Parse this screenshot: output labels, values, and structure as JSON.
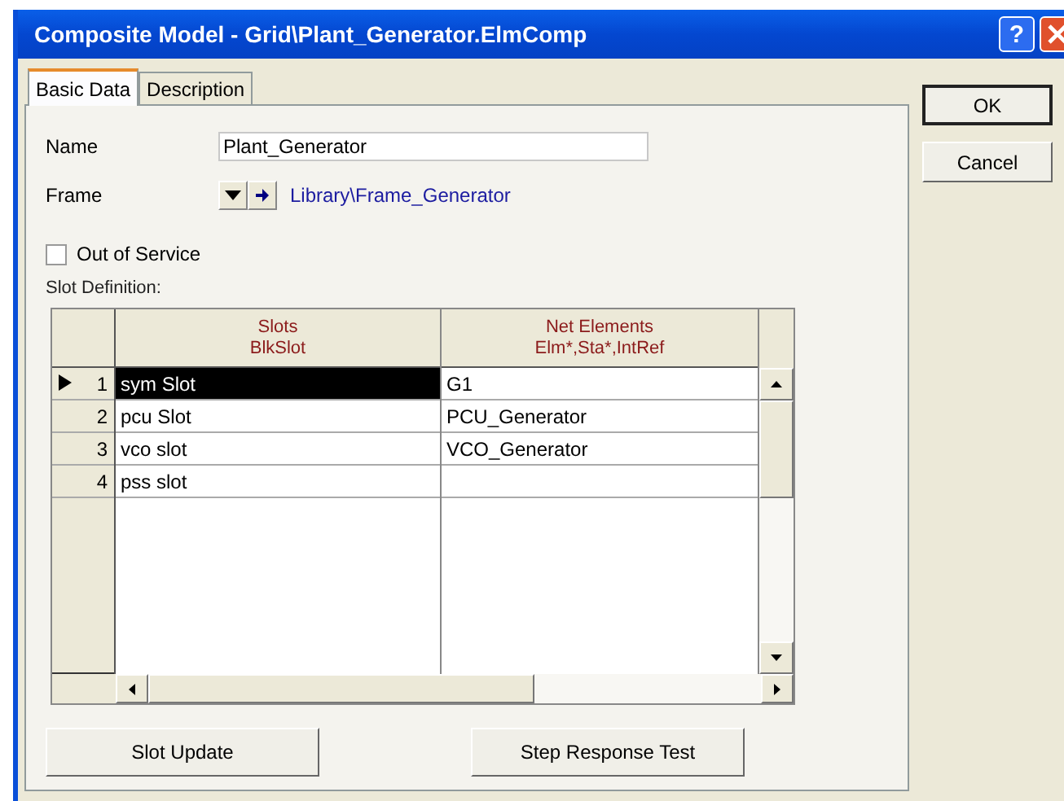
{
  "window": {
    "title": "Composite Model - Grid\\Plant_Generator.ElmComp",
    "help_button": "?"
  },
  "tabs": [
    {
      "label": "Basic Data",
      "selected": true
    },
    {
      "label": "Description",
      "selected": false
    }
  ],
  "buttons": [
    "OK",
    "Cancel"
  ],
  "name": {
    "label": "Name",
    "value": "Plant_Generator"
  },
  "frame": {
    "label": "Frame",
    "link": "Library\\Frame_Generator"
  },
  "out_of_service": {
    "label": "Out of Service",
    "checked": false
  },
  "slot_definition": {
    "label": "Slot Definition:",
    "columns": [
      {
        "title": "Slots",
        "subtitle": "BlkSlot"
      },
      {
        "title": "Net Elements",
        "subtitle": "Elm*,Sta*,IntRef"
      }
    ],
    "rows": [
      {
        "number": "1",
        "slot": "sym Slot",
        "element": "G1",
        "selected": true
      },
      {
        "number": "2",
        "slot": "pcu Slot",
        "element": "PCU_Generator",
        "selected": false
      },
      {
        "number": "3",
        "slot": "vco slot",
        "element": "VCO_Generator",
        "selected": false
      },
      {
        "number": "4",
        "slot": "pss slot",
        "element": "",
        "selected": false
      }
    ]
  },
  "bottom_buttons": [
    "Slot Update",
    "Step Response Test"
  ]
}
